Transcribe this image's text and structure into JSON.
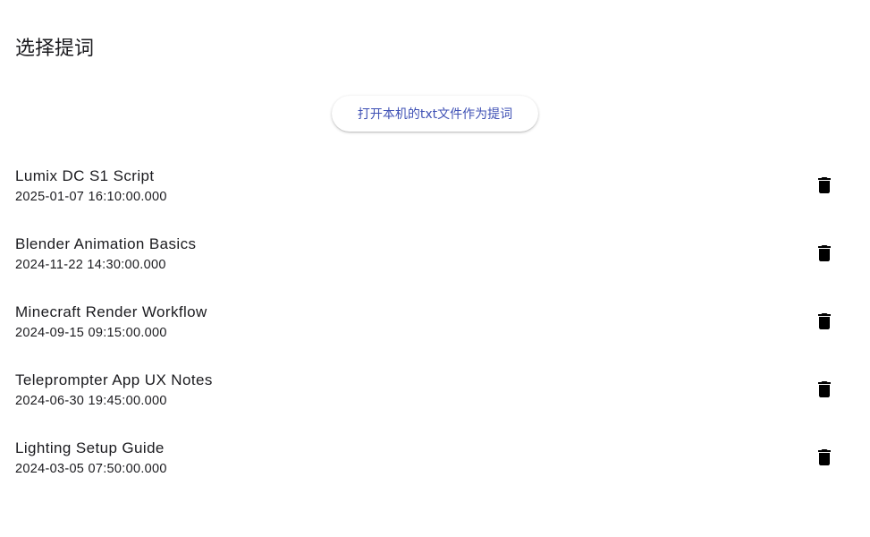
{
  "header": {
    "title": "选择提词"
  },
  "actions": {
    "open_txt_label": "打开本机的txt文件作为提词"
  },
  "colors": {
    "accent": "#3f51b5",
    "text": "#1b1b1f",
    "background": "#ffffff"
  },
  "scripts": [
    {
      "title": "Lumix DC S1 Script",
      "datetime": "2025-01-07 16:10:00.000",
      "action_icon": "delete-icon"
    },
    {
      "title": "Blender Animation Basics",
      "datetime": "2024-11-22 14:30:00.000",
      "action_icon": "delete-icon"
    },
    {
      "title": "Minecraft Render Workflow",
      "datetime": "2024-09-15 09:15:00.000",
      "action_icon": "delete-icon"
    },
    {
      "title": "Teleprompter App UX Notes",
      "datetime": "2024-06-30 19:45:00.000",
      "action_icon": "delete-icon"
    },
    {
      "title": "Lighting Setup Guide",
      "datetime": "2024-03-05 07:50:00.000",
      "action_icon": "delete-icon"
    }
  ]
}
